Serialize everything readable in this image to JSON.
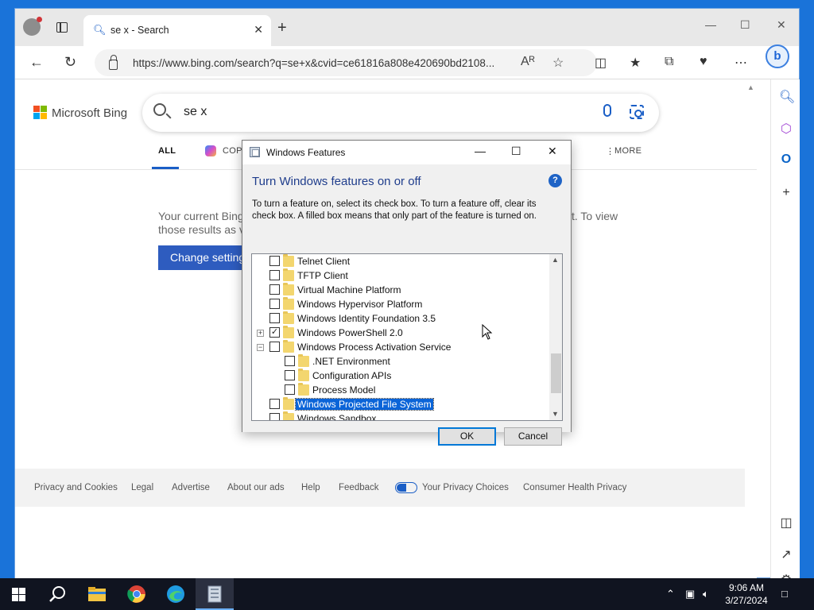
{
  "browser": {
    "tab_title": "se x - Search",
    "url": "https://www.bing.com/search?q=se+x&cvid=ce61816a808e420690bd2108..."
  },
  "bing": {
    "logo_text": "Microsoft Bing",
    "query": "se x",
    "scopes": [
      "ALL",
      "COPI",
      "MORE"
    ],
    "notice_left": "Your current Bing",
    "notice_left2": "those results as v",
    "notice_right": "t. To view",
    "change_settings": "Change settings",
    "footer_links": [
      "Privacy and Cookies",
      "Legal",
      "Advertise",
      "About our ads",
      "Help",
      "Feedback",
      "Your Privacy Choices",
      "Consumer Health Privacy"
    ]
  },
  "dialog": {
    "title": "Windows Features",
    "heading": "Turn Windows features on or off",
    "description": "To turn a feature on, select its check box. To turn a feature off, clear its check box. A filled box means that only part of the feature is turned on.",
    "help_label": "?",
    "ok_label": "OK",
    "cancel_label": "Cancel",
    "features": [
      {
        "label": "Telnet Client",
        "checked": false,
        "level": 0,
        "expander": ""
      },
      {
        "label": "TFTP Client",
        "checked": false,
        "level": 0,
        "expander": ""
      },
      {
        "label": "Virtual Machine Platform",
        "checked": false,
        "level": 0,
        "expander": ""
      },
      {
        "label": "Windows Hypervisor Platform",
        "checked": false,
        "level": 0,
        "expander": ""
      },
      {
        "label": "Windows Identity Foundation 3.5",
        "checked": false,
        "level": 0,
        "expander": ""
      },
      {
        "label": "Windows PowerShell 2.0",
        "checked": true,
        "level": 0,
        "expander": "+"
      },
      {
        "label": "Windows Process Activation Service",
        "checked": false,
        "level": 0,
        "expander": "-"
      },
      {
        "label": ".NET Environment",
        "checked": false,
        "level": 1,
        "expander": ""
      },
      {
        "label": "Configuration APIs",
        "checked": false,
        "level": 1,
        "expander": ""
      },
      {
        "label": "Process Model",
        "checked": false,
        "level": 1,
        "expander": ""
      },
      {
        "label": "Windows Projected File System",
        "checked": false,
        "level": 0,
        "expander": "",
        "selected": true
      },
      {
        "label": "Windows Sandbox",
        "checked": false,
        "level": 0,
        "expander": ""
      }
    ]
  },
  "taskbar": {
    "time": "9:06 AM",
    "date": "3/27/2024"
  },
  "colors": {
    "accent": "#1a5ec6",
    "selection": "#0a64d8",
    "desktop": "#1a73d9"
  }
}
